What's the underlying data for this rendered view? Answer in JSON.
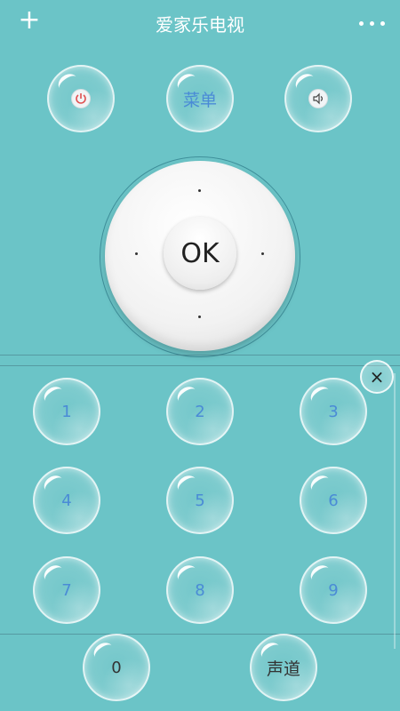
{
  "header": {
    "title": "爱家乐电视",
    "add_icon": "plus-icon",
    "more_icon": "more-dots-icon"
  },
  "top_controls": {
    "power_icon": "power-icon",
    "menu_label": "菜单",
    "volume_icon": "speaker-icon"
  },
  "dpad": {
    "ok_label": "OK"
  },
  "keypad": {
    "close_label": "×",
    "digits": [
      "1",
      "2",
      "3",
      "4",
      "5",
      "6",
      "7",
      "8",
      "9"
    ],
    "zero_label": "0",
    "channel_label": "声道"
  },
  "colors": {
    "background": "#6bc4c7",
    "digit_text": "#4a8bd6",
    "power_red": "#e05050"
  }
}
